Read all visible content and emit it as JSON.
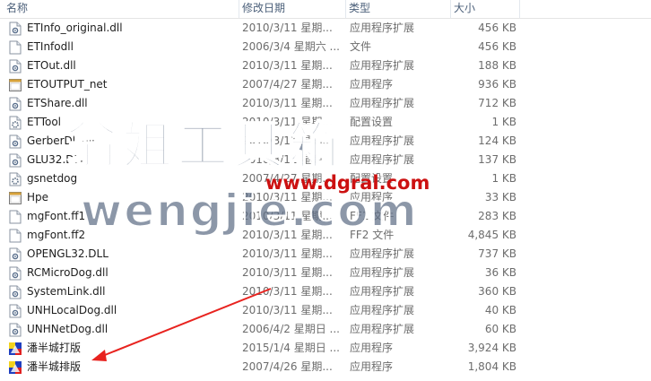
{
  "columns": {
    "name": "名称",
    "date": "修改日期",
    "type": "类型",
    "size": "大小"
  },
  "files": [
    {
      "name": "ETInfo_original.dll",
      "date": "2010/3/11 星期...",
      "type": "应用程序扩展",
      "size": "456 KB",
      "icon": "dll-icon"
    },
    {
      "name": "ETInfodll",
      "date": "2006/3/4 星期六 ...",
      "type": "文件",
      "size": "456 KB",
      "icon": "file-icon"
    },
    {
      "name": "ETOut.dll",
      "date": "2010/3/11 星期...",
      "type": "应用程序扩展",
      "size": "188 KB",
      "icon": "dll-icon"
    },
    {
      "name": "ETOUTPUT_net",
      "date": "2007/4/27 星期...",
      "type": "应用程序",
      "size": "936 KB",
      "icon": "exe-icon"
    },
    {
      "name": "ETShare.dll",
      "date": "2010/3/11 星期...",
      "type": "应用程序扩展",
      "size": "712 KB",
      "icon": "dll-icon"
    },
    {
      "name": "ETTool",
      "date": "2010/3/11 星期...",
      "type": "配置设置",
      "size": "1 KB",
      "icon": "settings-file-icon"
    },
    {
      "name": "GerberDll.dll",
      "date": "2010/3/11 星期...",
      "type": "应用程序扩展",
      "size": "124 KB",
      "icon": "dll-icon"
    },
    {
      "name": "GLU32.DLL",
      "date": "2010/3/11 星期...",
      "type": "应用程序扩展",
      "size": "137 KB",
      "icon": "dll-icon"
    },
    {
      "name": "gsnetdog",
      "date": "2007/4/27 星期...",
      "type": "配置设置",
      "size": "1 KB",
      "icon": "settings-file-icon"
    },
    {
      "name": "Hpe",
      "date": "2010/3/11 星期...",
      "type": "应用程序",
      "size": "33 KB",
      "icon": "exe-icon"
    },
    {
      "name": "mgFont.ff1",
      "date": "2010/3/11 星期...",
      "type": "FF1 文件",
      "size": "283 KB",
      "icon": "file-icon"
    },
    {
      "name": "mgFont.ff2",
      "date": "2010/3/11 星期...",
      "type": "FF2 文件",
      "size": "4,845 KB",
      "icon": "file-icon"
    },
    {
      "name": "OPENGL32.DLL",
      "date": "2010/3/11 星期...",
      "type": "应用程序扩展",
      "size": "737 KB",
      "icon": "dll-icon"
    },
    {
      "name": "RCMicroDog.dll",
      "date": "2010/3/11 星期...",
      "type": "应用程序扩展",
      "size": "36 KB",
      "icon": "dll-icon"
    },
    {
      "name": "SystemLink.dll",
      "date": "2010/3/11 星期...",
      "type": "应用程序扩展",
      "size": "360 KB",
      "icon": "dll-icon"
    },
    {
      "name": "UNHLocalDog.dll",
      "date": "2010/3/11 星期...",
      "type": "应用程序扩展",
      "size": "40 KB",
      "icon": "dll-icon"
    },
    {
      "name": "UNHNetDog.dll",
      "date": "2006/4/2 星期日 ...",
      "type": "应用程序扩展",
      "size": "60 KB",
      "icon": "dll-icon"
    },
    {
      "name": "潘半城打版",
      "date": "2015/1/4 星期日 ...",
      "type": "应用程序",
      "size": "3,924 KB",
      "icon": "app-icon"
    },
    {
      "name": "潘半城排版",
      "date": "2007/4/26 星期...",
      "type": "应用程序",
      "size": "1,804 KB",
      "icon": "app-icon"
    }
  ],
  "watermark": {
    "chinese": "翁姐工具箱",
    "url_small": "www.dgral.com",
    "url_large": "wengjie.com"
  },
  "colors": {
    "header_text": "#4c607a",
    "arrow": "#e8231f",
    "watermark_fill": "#5f6f86",
    "url_red": "#cc1111"
  }
}
